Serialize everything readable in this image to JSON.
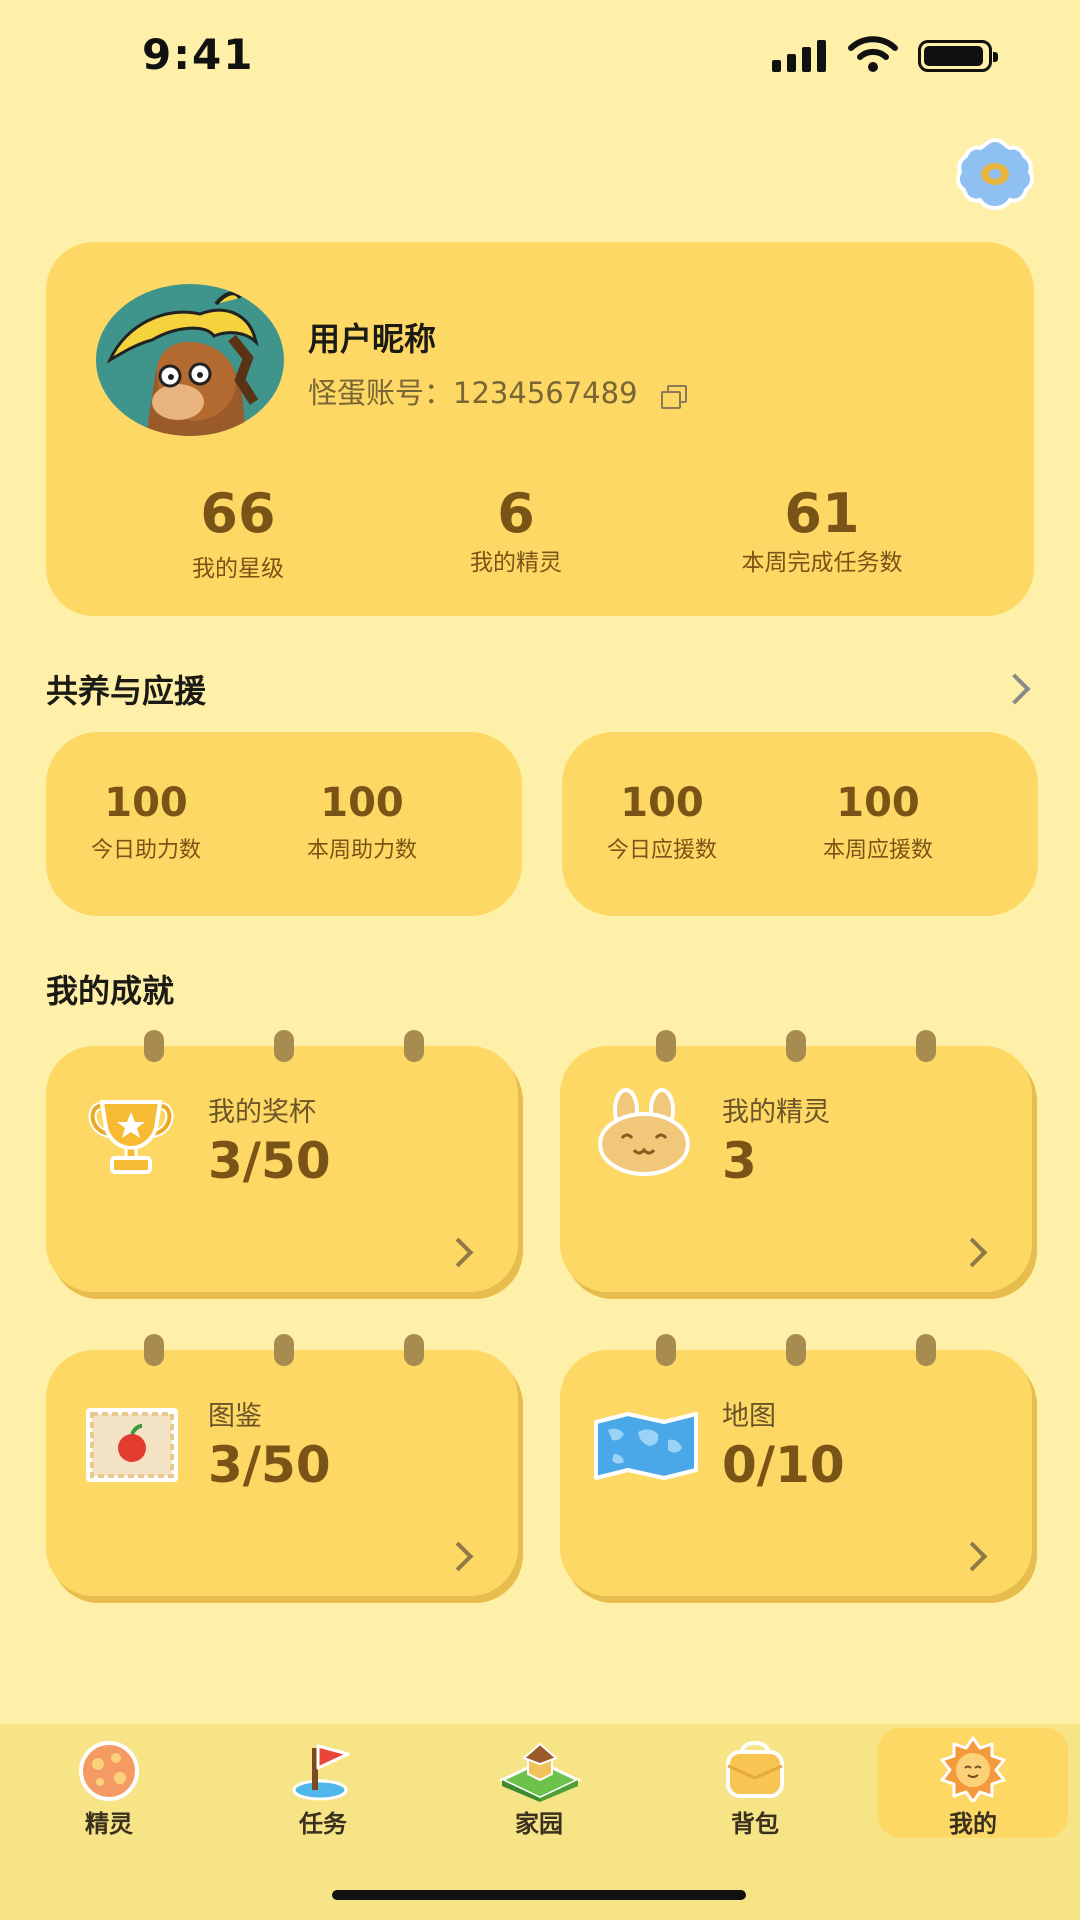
{
  "status_bar": {
    "time": "9:41"
  },
  "profile": {
    "nickname": "用户昵称",
    "account_label": "怪蛋账号：",
    "account_id": "1234567489",
    "stats": [
      {
        "value": "66",
        "label": "我的星级"
      },
      {
        "value": "6",
        "label": "我的精灵"
      },
      {
        "value": "61",
        "label": "本周完成任务数"
      }
    ]
  },
  "support": {
    "title": "共养与应援",
    "cards": [
      {
        "items": [
          {
            "value": "100",
            "label": "今日助力数"
          },
          {
            "value": "100",
            "label": "本周助力数"
          }
        ]
      },
      {
        "items": [
          {
            "value": "100",
            "label": "今日应援数"
          },
          {
            "value": "100",
            "label": "本周应援数"
          }
        ]
      }
    ]
  },
  "achievements": {
    "title": "我的成就",
    "cards": [
      {
        "title": "我的奖杯",
        "value": "3/50",
        "icon": "trophy-icon"
      },
      {
        "title": "我的精灵",
        "value": "3",
        "icon": "bunny-icon"
      },
      {
        "title": "图鉴",
        "value": "3/50",
        "icon": "stamp-icon"
      },
      {
        "title": "地图",
        "value": "0/10",
        "icon": "map-icon"
      }
    ]
  },
  "tabbar": {
    "active": "我的",
    "items": [
      {
        "label": "精灵",
        "icon": "cookie-icon"
      },
      {
        "label": "任务",
        "icon": "flag-icon"
      },
      {
        "label": "家园",
        "icon": "house-icon"
      },
      {
        "label": "背包",
        "icon": "bag-icon"
      },
      {
        "label": "我的",
        "icon": "sun-face-icon"
      }
    ]
  }
}
